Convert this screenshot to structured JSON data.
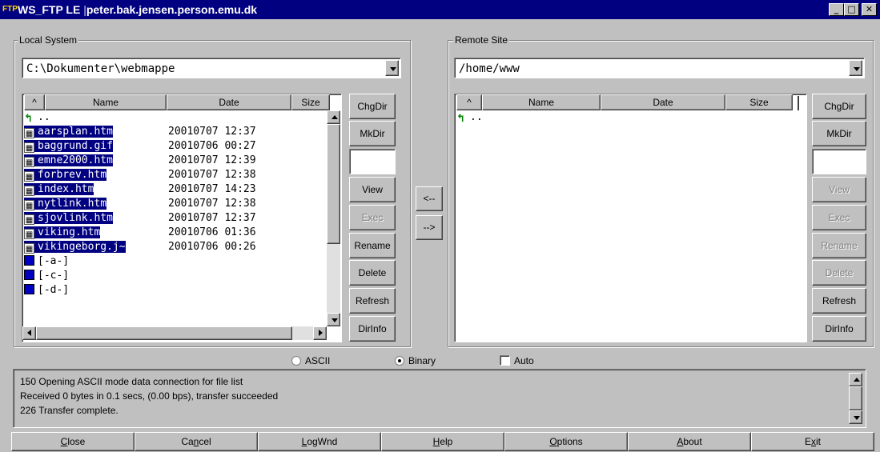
{
  "window": {
    "title": "WS_FTP LE",
    "host": "peter.bak.jensen.person.emu.dk",
    "icon": "ftp-app-icon",
    "controls": {
      "minimize": "_",
      "maximize": "□",
      "close": "✕"
    }
  },
  "local": {
    "group_label": "Local System",
    "path": "C:\\Dokumenter\\webmappe",
    "columns": {
      "sort": "^",
      "name": "Name",
      "date": "Date",
      "size": "Size"
    },
    "up_entry": "..",
    "files": [
      {
        "name": "aarsplan.htm",
        "date": "20010707 12:37"
      },
      {
        "name": "baggrund.gif",
        "date": "20010706 00:27"
      },
      {
        "name": "emne2000.htm",
        "date": "20010707 12:39"
      },
      {
        "name": "forbrev.htm",
        "date": "20010707 12:38"
      },
      {
        "name": "index.htm",
        "date": "20010707 14:23"
      },
      {
        "name": "nytlink.htm",
        "date": "20010707 12:38"
      },
      {
        "name": "sjovlink.htm",
        "date": "20010707 12:37"
      },
      {
        "name": "viking.htm",
        "date": "20010706 01:36"
      },
      {
        "name": "vikingeborg.j~",
        "date": "20010706 00:26"
      }
    ],
    "drives": [
      "[-a-]",
      "[-c-]",
      "[-d-]"
    ],
    "buttons": {
      "chgdir": "ChgDir",
      "mkdir": "MkDir",
      "view": "View",
      "exec": "Exec",
      "rename": "Rename",
      "delete": "Delete",
      "refresh": "Refresh",
      "dirinfo": "DirInfo"
    }
  },
  "remote": {
    "group_label": "Remote Site",
    "path": "/home/www",
    "columns": {
      "sort": "^",
      "name": "Name",
      "date": "Date",
      "size": "Size"
    },
    "up_entry": "..",
    "buttons": {
      "chgdir": "ChgDir",
      "mkdir": "MkDir",
      "view": "View",
      "exec": "Exec",
      "rename": "Rename",
      "delete": "Delete",
      "refresh": "Refresh",
      "dirinfo": "DirInfo"
    }
  },
  "transfer": {
    "to_local": "<--",
    "to_remote": "-->"
  },
  "mode": {
    "ascii": "ASCII",
    "binary": "Binary",
    "auto": "Auto",
    "selected": "Binary",
    "auto_checked": false
  },
  "log": [
    "150 Opening ASCII mode data connection for file list",
    "Received 0 bytes in 0.1 secs, (0.00 bps), transfer succeeded",
    "226 Transfer complete."
  ],
  "bottom_buttons": {
    "close": {
      "pre": "",
      "acc": "C",
      "post": "lose"
    },
    "cancel": {
      "pre": "Ca",
      "acc": "n",
      "post": "cel"
    },
    "logwnd": {
      "pre": "",
      "acc": "L",
      "post": "ogWnd"
    },
    "help": {
      "pre": "",
      "acc": "H",
      "post": "elp"
    },
    "options": {
      "pre": "",
      "acc": "O",
      "post": "ptions"
    },
    "about": {
      "pre": "",
      "acc": "A",
      "post": "bout"
    },
    "exit": {
      "pre": "E",
      "acc": "x",
      "post": "it"
    }
  }
}
